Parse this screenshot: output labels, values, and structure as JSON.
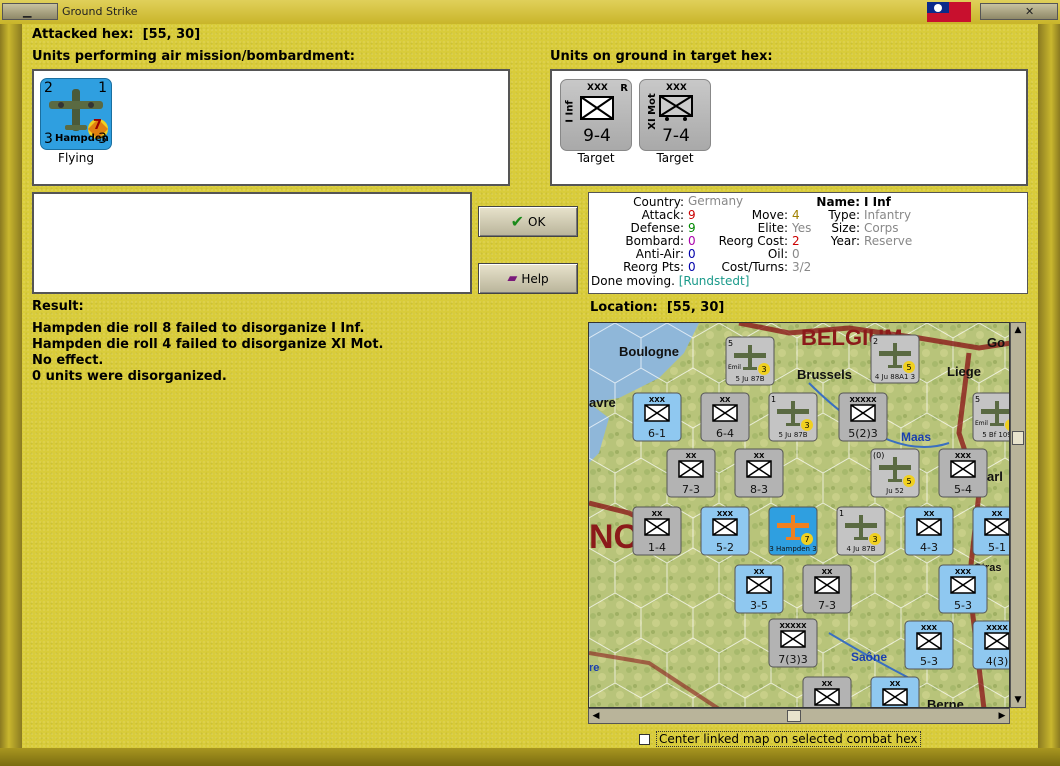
{
  "window": {
    "title": "Ground Strike"
  },
  "attacked_hex": {
    "label": "Attacked hex:",
    "value": "[55, 30]"
  },
  "air_units": {
    "label": "Units performing air mission/bombardment:",
    "items": [
      {
        "name": "Hampden",
        "attack": "2",
        "top_right": "1",
        "bottom_left": "3",
        "bottom_right": "3",
        "badge": "7",
        "status": "Flying"
      }
    ]
  },
  "ground_units": {
    "label": "Units on ground in target hex:",
    "items": [
      {
        "side_label": "I Inf",
        "size": "XXX",
        "flag": "R",
        "strength": "9-4",
        "status": "Target"
      },
      {
        "side_label": "XI Mot",
        "size": "XXX",
        "flag": "",
        "strength": "7-4",
        "status": "Target"
      }
    ]
  },
  "buttons": {
    "ok": "OK",
    "help": "Help"
  },
  "unit_info": {
    "country_label": "Country:",
    "country": "Germany",
    "attack_label": "Attack:",
    "attack": "9",
    "defense_label": "Defense:",
    "defense": "9",
    "bombard_label": "Bombard:",
    "bombard": "0",
    "antiair_label": "Anti-Air:",
    "antiair": "0",
    "reorg_pts_label": "Reorg Pts:",
    "reorg_pts": "0",
    "move_label": "Move:",
    "move": "4",
    "elite_label": "Elite:",
    "elite": "Yes",
    "reorg_cost_label": "Reorg Cost:",
    "reorg_cost": "2",
    "oil_label": "Oil:",
    "oil": "0",
    "cost_turns_label": "Cost/Turns:",
    "cost_turns": "3/2",
    "name_label": "Name:",
    "name": "I Inf",
    "type_label": "Type:",
    "type": "Infantry",
    "size_label": "Size:",
    "size": "Corps",
    "year_label": "Year:",
    "year": "Reserve",
    "done_text": "Done moving.",
    "commander": "[Rundstedt]"
  },
  "result": {
    "label": "Result:",
    "lines": [
      "Hampden die roll 8 failed to disorganize I Inf.",
      "Hampden die roll 4 failed to disorganize XI Mot.",
      "No effect.",
      "0 units were disorganized."
    ]
  },
  "location": {
    "label": "Location:",
    "value": "[55, 30]"
  },
  "map": {
    "places": [
      "BELGIUM",
      "Boulogne",
      "Brussels",
      "Liege",
      "Maas",
      "Saône",
      "Berne",
      "avre",
      "Go",
      "arl",
      "Stras",
      "re",
      "NC"
    ],
    "counters": [
      {
        "id": "c1",
        "type": "air",
        "text": "5 Ju 87B",
        "num": "3",
        "top": "5",
        "top2": "Emil",
        "bot": "2"
      },
      {
        "id": "c2",
        "type": "air",
        "text": "4 Ju 88A1 3",
        "num": "5",
        "top": "2",
        "bot": "4"
      },
      {
        "id": "c3",
        "type": "blue",
        "text": "6-1",
        "size": "XXX"
      },
      {
        "id": "c4",
        "type": "grey",
        "text": "6-4",
        "size": "XX"
      },
      {
        "id": "c5",
        "type": "air",
        "text": "5 Ju 87B",
        "num": "3",
        "top": "1",
        "bot": "5"
      },
      {
        "id": "c6",
        "type": "grey",
        "text": "5(2)3",
        "size": "XXXXX"
      },
      {
        "id": "c7",
        "type": "air",
        "text": "5 Bf 109",
        "num": "3",
        "top": "5",
        "top2": "Emil",
        "bot": "2"
      },
      {
        "id": "c8",
        "type": "grey",
        "text": "7-3",
        "size": "XX"
      },
      {
        "id": "c9",
        "type": "grey",
        "text": "8-3",
        "size": "XX"
      },
      {
        "id": "c10",
        "type": "air",
        "text": "Ju 52",
        "num": "5",
        "top": "(0)",
        "bot": "4"
      },
      {
        "id": "c11",
        "type": "grey",
        "text": "5-4",
        "size": "XXX"
      },
      {
        "id": "c12",
        "type": "grey",
        "text": "1-4",
        "size": "XX"
      },
      {
        "id": "c13",
        "type": "blue",
        "text": "5-2",
        "size": "XXX"
      },
      {
        "id": "c14",
        "type": "bluefire",
        "text": "3 Hampden 3",
        "num": "7"
      },
      {
        "id": "c15",
        "type": "air",
        "text": "4 Ju 87B",
        "num": "3",
        "top": "1",
        "bot": "4"
      },
      {
        "id": "c16",
        "type": "blue",
        "text": "4-3",
        "size": "XX"
      },
      {
        "id": "c17",
        "type": "blue",
        "text": "5-1",
        "size": "XX"
      },
      {
        "id": "c18",
        "type": "blue",
        "text": "3-5",
        "size": "XX"
      },
      {
        "id": "c19",
        "type": "grey",
        "text": "7-3",
        "size": "XX"
      },
      {
        "id": "c20",
        "type": "blue",
        "text": "5-3",
        "size": "XXX"
      },
      {
        "id": "c21",
        "type": "grey",
        "text": "7(3)3",
        "size": "XXXXX"
      },
      {
        "id": "c22",
        "type": "blue",
        "text": "5-3",
        "size": "XXX"
      },
      {
        "id": "c23",
        "type": "blue",
        "text": "4(3)",
        "size": "XXXX"
      },
      {
        "id": "c24",
        "type": "grey",
        "text": "",
        "size": "XX"
      },
      {
        "id": "c25",
        "type": "blue",
        "text": "",
        "size": "XX"
      }
    ]
  },
  "footer": {
    "center_link_label": "Center linked map on selected combat hex"
  }
}
